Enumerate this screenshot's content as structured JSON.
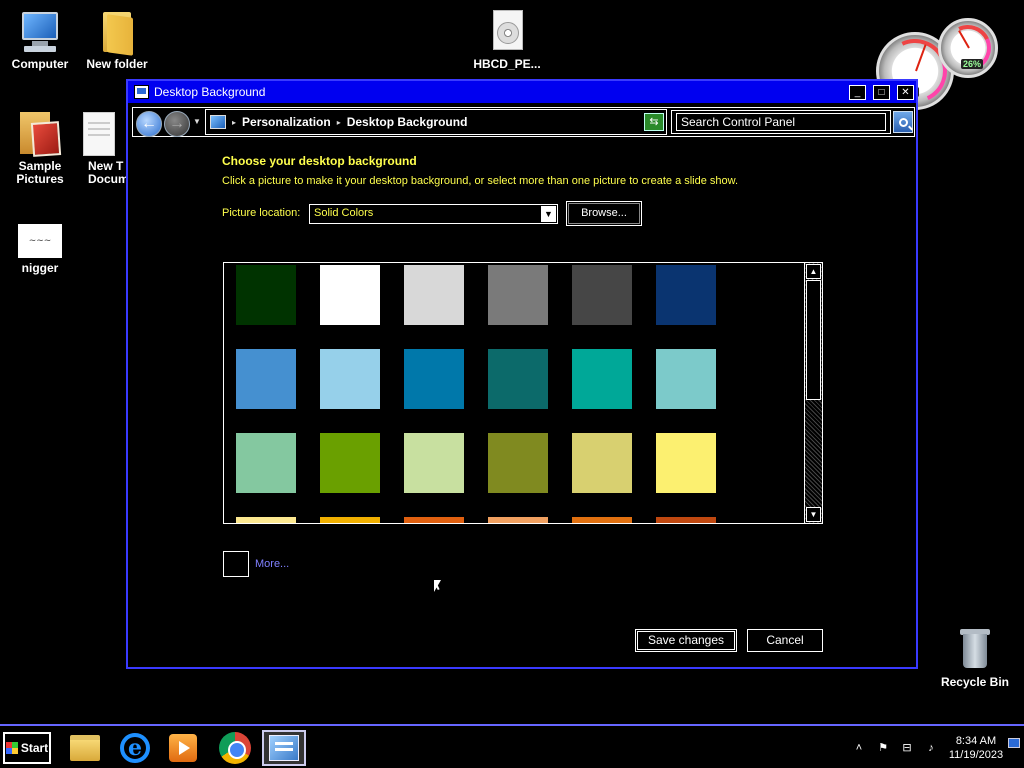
{
  "desktop": {
    "icons": {
      "computer": "Computer",
      "new_folder": "New folder",
      "hbcd": "HBCD_PE...",
      "sample_pictures_1": "Sample",
      "sample_pictures_2": "Pictures",
      "new_text_1": "New T",
      "new_text_2": "Docum",
      "signature": "nigger",
      "recycle_bin": "Recycle Bin"
    },
    "gadget": {
      "cpu_percent": "26%",
      "ram_percent": "%"
    }
  },
  "window": {
    "title": "Desktop Background",
    "controls": {
      "minimize": "_",
      "maximize": "□",
      "close": "✕"
    },
    "address": {
      "breadcrumb_1": "Personalization",
      "breadcrumb_2": "Desktop Background",
      "separator": "▸",
      "dropdown": "▽"
    },
    "search": {
      "placeholder": "Search Control Panel"
    },
    "content": {
      "heading": "Choose your desktop background",
      "subtext": "Click a picture to make it your desktop background, or select more than one picture to create a slide show.",
      "picture_location_label": "Picture location:",
      "picture_location_value": "Solid Colors",
      "browse": "Browse...",
      "more": "More...",
      "save": "Save changes",
      "cancel": "Cancel"
    },
    "swatches": [
      [
        "#003300",
        "#ffffff",
        "#d8d8d8",
        "#7a7a7a",
        "#464646",
        "#0a3470"
      ],
      [
        "#4590d0",
        "#96d0ea",
        "#0078aa",
        "#0c6a6a",
        "#00a898",
        "#7ccaca"
      ],
      [
        "#84c8a0",
        "#6aa000",
        "#c8e0a0",
        "#808a20",
        "#d8d070",
        "#fcf070"
      ],
      [
        "#fce890",
        "#f0b000",
        "#e06010",
        "#f0a060",
        "#e07010",
        "#c04810"
      ]
    ]
  },
  "taskbar": {
    "start": "Start",
    "apps": [
      "Windows Explorer",
      "Internet Explorer",
      "Media Player",
      "Google Chrome",
      "Control Panel"
    ],
    "tray": {
      "chevron": "˄",
      "time": "8:34 AM",
      "date": "11/19/2023"
    }
  }
}
